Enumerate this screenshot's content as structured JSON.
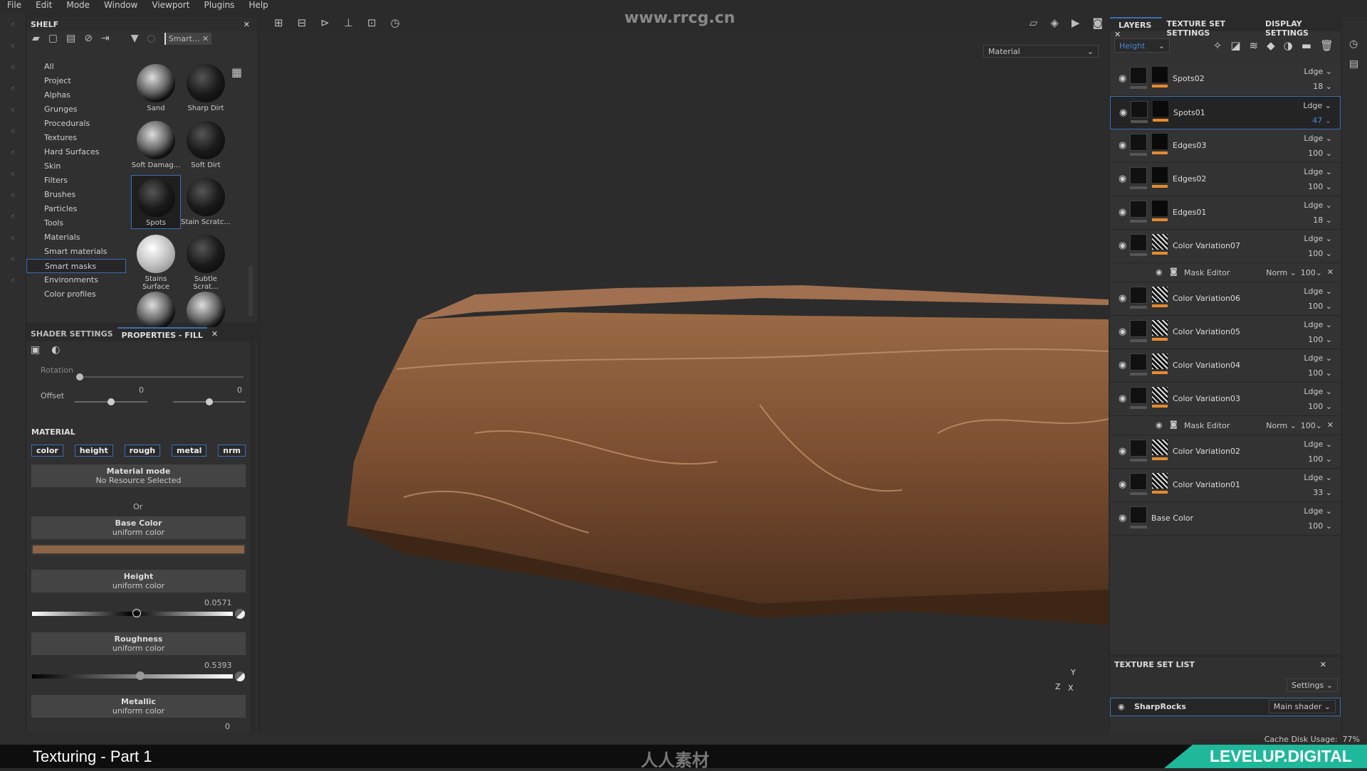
{
  "menu": [
    "File",
    "Edit",
    "Mode",
    "Window",
    "Viewport",
    "Plugins",
    "Help"
  ],
  "watermark_top": "www.rrcg.cn",
  "shelf": {
    "title": "SHELF",
    "search_tag": "Smart...",
    "categories": [
      "All",
      "Project",
      "Alphas",
      "Grunges",
      "Procedurals",
      "Textures",
      "Hard Surfaces",
      "Skin",
      "Filters",
      "Brushes",
      "Particles",
      "Tools",
      "Materials",
      "Smart materials",
      "Smart masks",
      "Environments",
      "Color profiles"
    ],
    "selected_category": "Smart masks",
    "items": [
      {
        "label": "Sand",
        "style": "light"
      },
      {
        "label": "Sharp Dirt",
        "style": "dark"
      },
      {
        "label": "Soft Damag...",
        "style": "light"
      },
      {
        "label": "Soft Dirt",
        "style": "dark"
      },
      {
        "label": "Spots",
        "style": "dark",
        "selected": true
      },
      {
        "label": "Stain Scratc...",
        "style": "dark"
      },
      {
        "label": "Stains Surface",
        "style": "white"
      },
      {
        "label": "Subtle Scrat...",
        "style": "dark"
      },
      {
        "label": "",
        "style": "light"
      },
      {
        "label": "",
        "style": "light"
      }
    ]
  },
  "props": {
    "tabs": [
      "SHADER SETTINGS",
      "PROPERTIES - FILL"
    ],
    "rotation_label": "Rotation",
    "offset_label": "Offset",
    "offset_values": [
      "0",
      "0"
    ],
    "material_title": "MATERIAL",
    "channels": [
      "color",
      "height",
      "rough",
      "metal",
      "nrm"
    ],
    "material_mode": {
      "title": "Material mode",
      "sub": "No Resource Selected"
    },
    "or": "Or",
    "base_color": {
      "title": "Base Color",
      "sub": "uniform color",
      "color": "#8a6446"
    },
    "height": {
      "title": "Height",
      "sub": "uniform color",
      "value": "0.0571"
    },
    "roughness": {
      "title": "Roughness",
      "sub": "uniform color",
      "value": "0.5393"
    },
    "metallic": {
      "title": "Metallic",
      "sub": "uniform color",
      "value": "0"
    }
  },
  "viewport": {
    "channel_select": "Material",
    "axis": {
      "y": "Y",
      "z": "Z",
      "x": "X"
    }
  },
  "layers": {
    "tabs": [
      "LAYERS",
      "TEXTURE SET SETTINGS",
      "DISPLAY SETTINGS"
    ],
    "channel": "Height",
    "rows": [
      {
        "type": "layer",
        "name": "Spots02",
        "blend": "Ldge",
        "opacity": "18"
      },
      {
        "type": "layer",
        "name": "Spots01",
        "blend": "Ldge",
        "opacity": "47",
        "selected": true
      },
      {
        "type": "layer",
        "name": "Edges03",
        "blend": "Ldge",
        "opacity": "100"
      },
      {
        "type": "layer",
        "name": "Edges02",
        "blend": "Ldge",
        "opacity": "100"
      },
      {
        "type": "layer",
        "name": "Edges01",
        "blend": "Ldge",
        "opacity": "18"
      },
      {
        "type": "layer",
        "name": "Color Variation07",
        "blend": "Ldge",
        "opacity": "100"
      },
      {
        "type": "mask",
        "name": "Mask Editor",
        "blend": "Norm",
        "opacity": "100"
      },
      {
        "type": "layer",
        "name": "Color Variation06",
        "blend": "Ldge",
        "opacity": "100"
      },
      {
        "type": "layer",
        "name": "Color Variation05",
        "blend": "Ldge",
        "opacity": "100"
      },
      {
        "type": "layer",
        "name": "Color Variation04",
        "blend": "Ldge",
        "opacity": "100"
      },
      {
        "type": "layer",
        "name": "Color Variation03",
        "blend": "Ldge",
        "opacity": "100"
      },
      {
        "type": "mask",
        "name": "Mask Editor",
        "blend": "Norm",
        "opacity": "100"
      },
      {
        "type": "layer",
        "name": "Color Variation02",
        "blend": "Ldge",
        "opacity": "100"
      },
      {
        "type": "layer",
        "name": "Color Variation01",
        "blend": "Ldge",
        "opacity": "33"
      },
      {
        "type": "base",
        "name": "Base Color",
        "blend": "Ldge",
        "opacity": "100"
      }
    ]
  },
  "texture_set_list": {
    "title": "TEXTURE SET LIST",
    "settings": "Settings",
    "set_name": "SharpRocks",
    "shader": "Main shader"
  },
  "status": {
    "cache_label": "Cache Disk Usage:",
    "cache_value": "77%"
  },
  "banner": {
    "title": "Texturing - Part 1",
    "brand": "LEVELUP.DIGITAL",
    "center_logo": "人人素材"
  },
  "colors": {
    "accent": "#3a6fb5",
    "layer_orange": "#e88a2c",
    "brand_teal": "#1fb89a"
  }
}
